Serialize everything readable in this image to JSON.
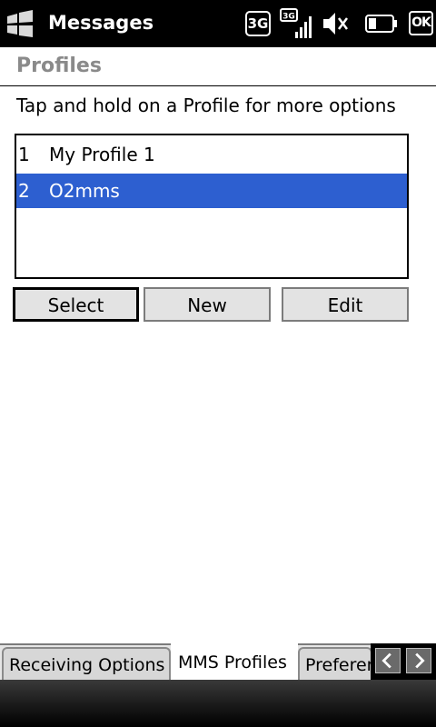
{
  "status_bar": {
    "app_title": "Messages",
    "network_badge": "3G",
    "signal_badge": "3G",
    "ok_label": "OK",
    "icons": [
      "windows-start-icon",
      "signal-icon",
      "sound-muted-icon",
      "battery-icon"
    ]
  },
  "page": {
    "title": "Profiles",
    "hint": "Tap and hold on a Profile for more options"
  },
  "profiles": [
    {
      "number": "1",
      "name": "My Profile 1",
      "selected": false
    },
    {
      "number": "2",
      "name": "O2mms",
      "selected": true
    }
  ],
  "buttons": {
    "select": "Select",
    "new": "New",
    "edit": "Edit"
  },
  "tabs": [
    {
      "label": "Receiving Options",
      "active": false
    },
    {
      "label": "MMS Profiles",
      "active": true
    },
    {
      "label": "Preferences",
      "active": false
    }
  ],
  "colors": {
    "selection": "#2d5fd0",
    "title_gray": "#8a8a8a"
  }
}
